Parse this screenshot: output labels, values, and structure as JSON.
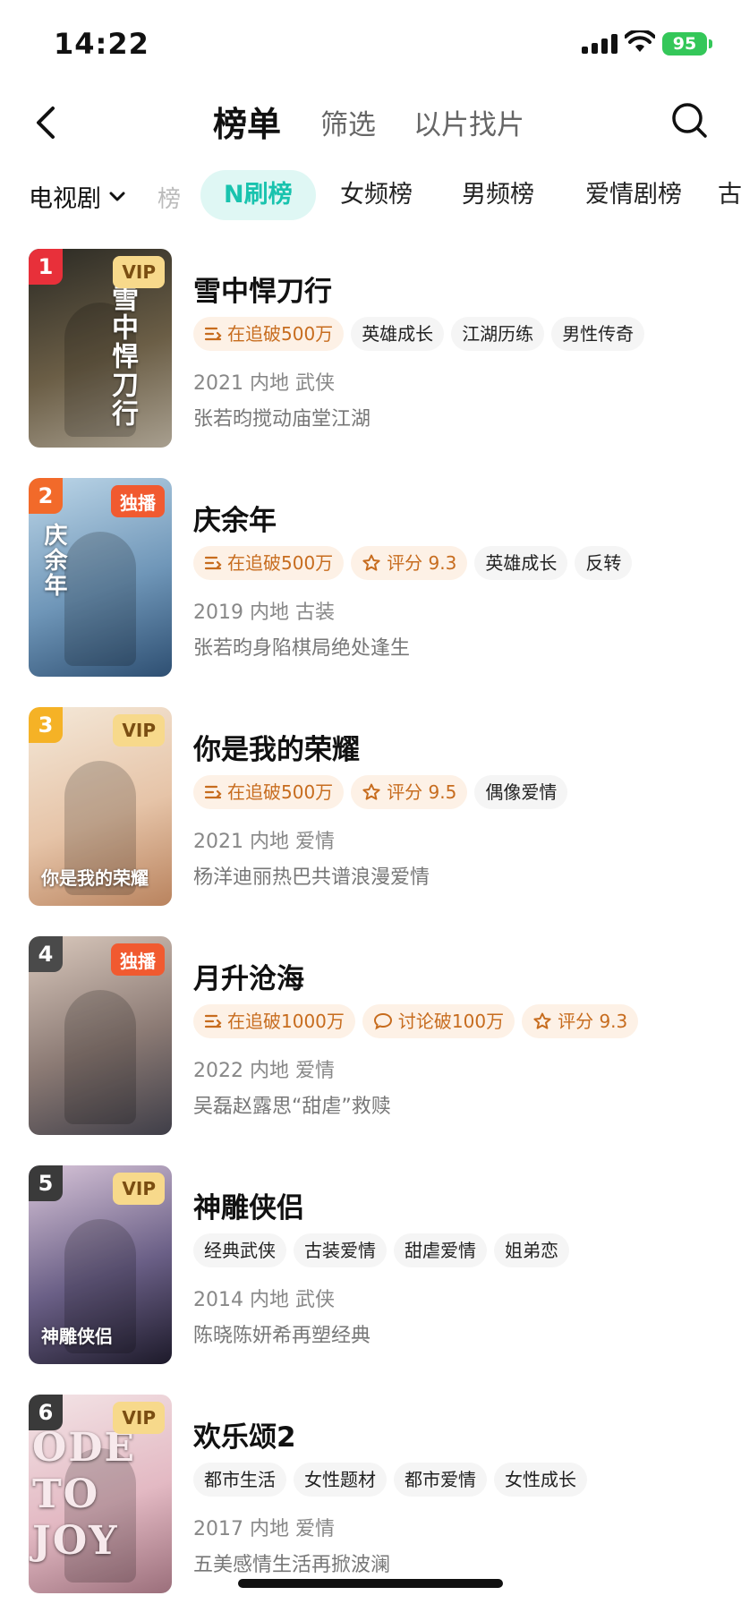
{
  "status_bar": {
    "time": "14:22",
    "battery": "95"
  },
  "nav": {
    "title": "榜单",
    "tabs": [
      "筛选",
      "以片找片"
    ]
  },
  "categories": {
    "dropdown": "电视剧",
    "partial": "榜",
    "tabs": [
      "N刷榜",
      "女频榜",
      "男频榜",
      "爱情剧榜",
      "古"
    ],
    "active_index": 0
  },
  "items": [
    {
      "rank": "1",
      "badge": "VIP",
      "title": "雪中悍刀行",
      "chips": [
        {
          "icon": "trend-icon",
          "text": "在追破500万",
          "style": "hot"
        },
        {
          "text": "英雄成长"
        },
        {
          "text": "江湖历练"
        },
        {
          "text": "男性传奇"
        }
      ],
      "meta": "2021 内地 武侠",
      "desc": "张若昀搅动庙堂江湖",
      "rank_color": "#e8303a",
      "poster_colors": [
        "#2b2a24",
        "#6b5e46",
        "#a89f8f"
      ]
    },
    {
      "rank": "2",
      "badge": "独播",
      "title": "庆余年",
      "chips": [
        {
          "icon": "trend-icon",
          "text": "在追破500万",
          "style": "hot"
        },
        {
          "icon": "star-icon",
          "text": "评分 9.3",
          "style": "hot"
        },
        {
          "text": "英雄成长"
        },
        {
          "text": "反转"
        }
      ],
      "meta": "2019 内地 古装",
      "desc": "张若昀身陷棋局绝处逢生",
      "rank_color": "#f26a2a",
      "poster_colors": [
        "#bcd6e8",
        "#6f96b8",
        "#2e4f72"
      ]
    },
    {
      "rank": "3",
      "badge": "VIP",
      "title": "你是我的荣耀",
      "chips": [
        {
          "icon": "trend-icon",
          "text": "在追破500万",
          "style": "hot"
        },
        {
          "icon": "star-icon",
          "text": "评分 9.5",
          "style": "hot"
        },
        {
          "text": "偶像爱情"
        }
      ],
      "meta": "2021 内地 爱情",
      "desc": "杨洋迪丽热巴共谱浪漫爱情",
      "rank_color": "#f5b226",
      "poster_colors": [
        "#f4e8d8",
        "#e6c4a8",
        "#b9835e"
      ]
    },
    {
      "rank": "4",
      "badge": "独播",
      "title": "月升沧海",
      "chips": [
        {
          "icon": "trend-icon",
          "text": "在追破1000万",
          "style": "hot"
        },
        {
          "icon": "chat-icon",
          "text": "讨论破100万",
          "style": "hot"
        },
        {
          "icon": "star-icon",
          "text": "评分 9.3",
          "style": "hot"
        }
      ],
      "meta": "2022 内地 爱情",
      "desc": "吴磊赵露思“甜虐”救赎",
      "rank_color": "#4a4a4a",
      "poster_colors": [
        "#d9c8bc",
        "#8b7a74",
        "#3f3e48"
      ]
    },
    {
      "rank": "5",
      "badge": "VIP",
      "title": "神雕侠侣",
      "chips": [
        {
          "text": "经典武侠"
        },
        {
          "text": "古装爱情"
        },
        {
          "text": "甜虐爱情"
        },
        {
          "text": "姐弟恋"
        }
      ],
      "meta": "2014 内地 武侠",
      "desc": "陈晓陈妍希再塑经典",
      "rank_color": "#3a3a3a",
      "poster_colors": [
        "#d7c4d8",
        "#6a5f86",
        "#1d1a2a"
      ]
    },
    {
      "rank": "6",
      "badge": "VIP",
      "title": "欢乐颂2",
      "chips": [
        {
          "text": "都市生活"
        },
        {
          "text": "女性题材"
        },
        {
          "text": "都市爱情"
        },
        {
          "text": "女性成长"
        }
      ],
      "meta": "2017 内地 爱情",
      "desc": "五美感情生活再掀波澜",
      "rank_color": "#3a3a3a",
      "poster_colors": [
        "#f3e4e6",
        "#e3b9c3",
        "#9b6f7b"
      ]
    }
  ],
  "poster_texts": [
    "雪中悍刀行",
    "庆余年",
    "你是我的荣耀",
    "",
    "神雕侠侣",
    "ODE TO JOY"
  ]
}
